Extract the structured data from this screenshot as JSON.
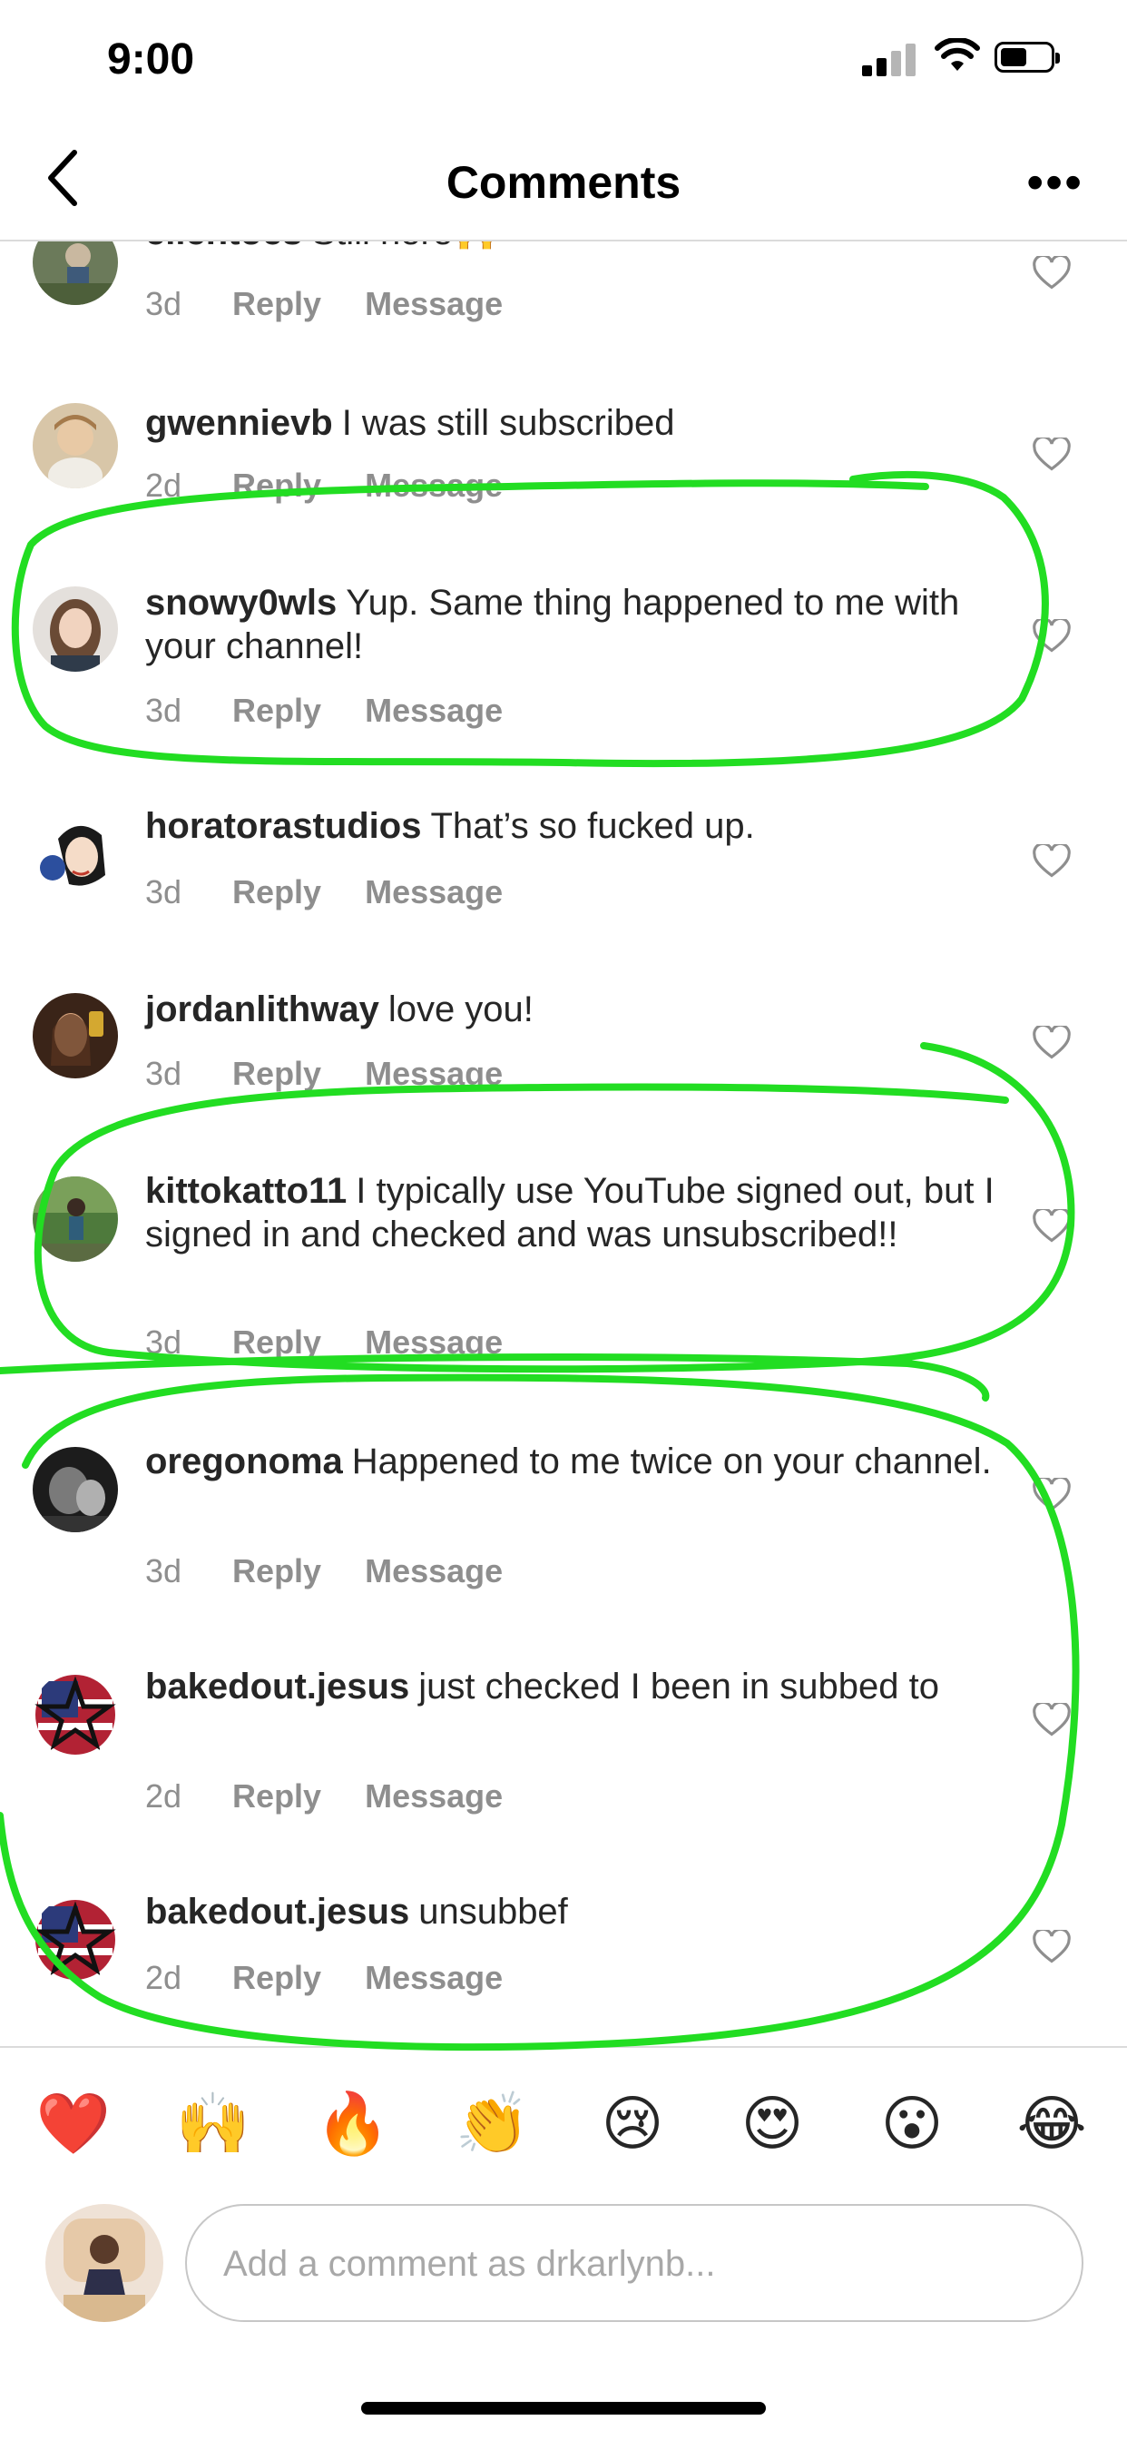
{
  "status_bar": {
    "time": "9:00"
  },
  "header": {
    "title": "Comments",
    "back_icon": "chevron-left-icon",
    "more_icon": "more-horizontal-icon",
    "more_label": "•••"
  },
  "comments": [
    {
      "username": "ellentoes",
      "text": "Still here🙌",
      "age": "3d",
      "reply_label": "Reply",
      "message_label": "Message"
    },
    {
      "username": "gwennievb",
      "text": "I was still subscribed",
      "age": "2d",
      "reply_label": "Reply",
      "message_label": "Message"
    },
    {
      "username": "snowy0wls",
      "text": "Yup. Same thing happened to me with your channel!",
      "age": "3d",
      "reply_label": "Reply",
      "message_label": "Message"
    },
    {
      "username": "horatorastudios",
      "text": "That’s so fucked up.",
      "age": "3d",
      "reply_label": "Reply",
      "message_label": "Message"
    },
    {
      "username": "jordanlithway",
      "text": "love you!",
      "age": "3d",
      "reply_label": "Reply",
      "message_label": "Message"
    },
    {
      "username": "kittokatto11",
      "text": "I typically use YouTube signed out, but I signed in and checked and was unsubscribed!!",
      "age": "3d",
      "reply_label": "Reply",
      "message_label": "Message"
    },
    {
      "username": "oregonoma",
      "text": "Happened to me twice on your channel.",
      "age": "3d",
      "reply_label": "Reply",
      "message_label": "Message"
    },
    {
      "username": "bakedout.jesus",
      "text": "just checked I been in subbed to",
      "age": "2d",
      "reply_label": "Reply",
      "message_label": "Message"
    },
    {
      "username": "bakedout.jesus",
      "text": "unsubbef",
      "age": "2d",
      "reply_label": "Reply",
      "message_label": "Message"
    }
  ],
  "emoji_bar": [
    "❤️",
    "🙌",
    "🔥",
    "👏",
    "😢",
    "😍",
    "😮",
    "😂"
  ],
  "composer": {
    "placeholder": "Add a comment as drkarlynb..."
  },
  "colors": {
    "annotation": "#22dd22",
    "meta_text": "#8e8e8e",
    "username": "#262626"
  }
}
